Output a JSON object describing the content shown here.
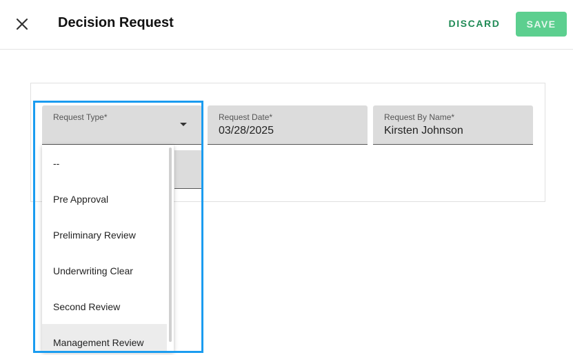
{
  "header": {
    "title": "Decision Request",
    "discard_label": "DISCARD",
    "save_label": "SAVE",
    "close_icon": "close-icon"
  },
  "form": {
    "request_type": {
      "label": "Request Type*",
      "value": ""
    },
    "request_date": {
      "label": "Request Date*",
      "value": "03/28/2025"
    },
    "request_by_name": {
      "label": "Request By Name*",
      "value": "Kirsten Johnson"
    }
  },
  "dropdown": {
    "options": [
      "--",
      "Pre Approval",
      "Preliminary Review",
      "Underwriting Clear",
      "Second Review",
      "Management Review"
    ],
    "hovered_index": 5
  },
  "colors": {
    "accent_green": "#1f8a55",
    "save_bg": "#5ccf8f",
    "highlight_blue": "#1a9cf0"
  }
}
